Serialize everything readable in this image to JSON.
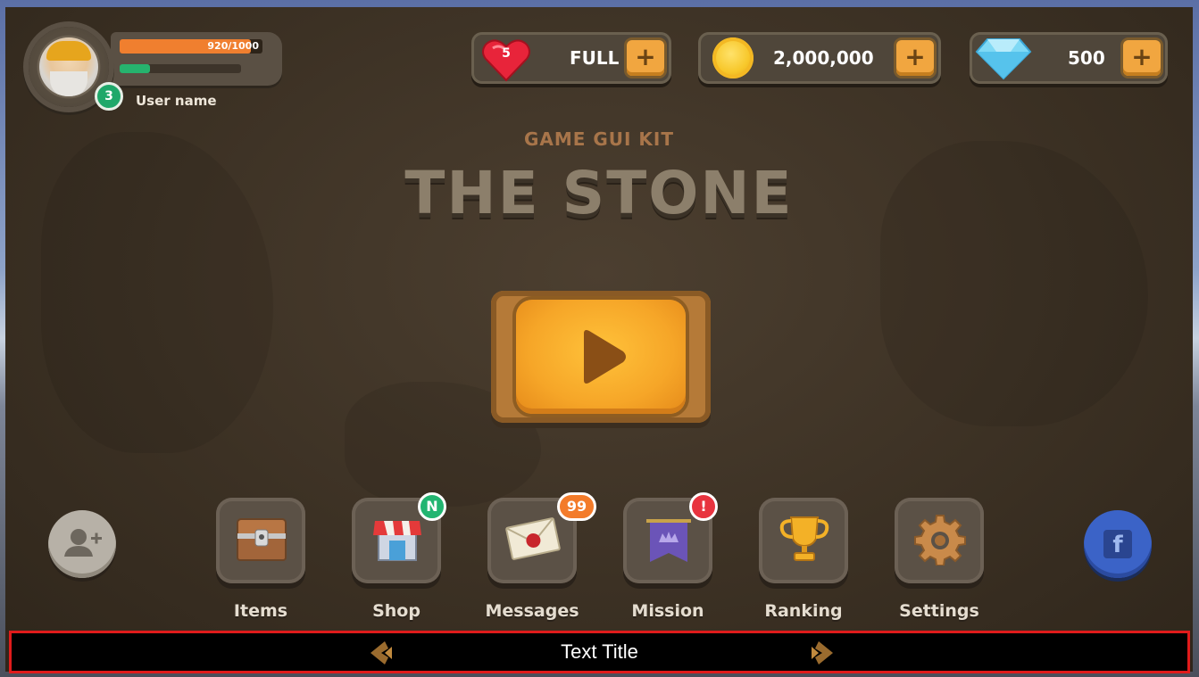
{
  "profile": {
    "level": "3",
    "username": "User name",
    "xp_text": "920/1000",
    "xp_fraction": 0.92,
    "secondary_fraction": 0.25
  },
  "resources": {
    "lives": {
      "icon": "heart-gem-icon",
      "count": "5",
      "status": "FULL",
      "add_label": "+"
    },
    "coins": {
      "icon": "coin-icon",
      "value": "2,000,000",
      "add_label": "+"
    },
    "gems": {
      "icon": "diamond-icon",
      "value": "500",
      "add_label": "+"
    }
  },
  "title": {
    "subtitle": "GAME GUI KIT",
    "main": "THE STONE"
  },
  "play": {
    "icon": "play-icon"
  },
  "menu": [
    {
      "label": "Items",
      "icon": "treasure-chest-icon"
    },
    {
      "label": "Shop",
      "icon": "shop-icon",
      "badge": "N"
    },
    {
      "label": "Messages",
      "icon": "envelope-icon",
      "badge": "99"
    },
    {
      "label": "Mission",
      "icon": "banner-icon",
      "badge": "!"
    },
    {
      "label": "Ranking",
      "icon": "trophy-icon"
    },
    {
      "label": "Settings",
      "icon": "gear-icon"
    }
  ],
  "side_buttons": {
    "add_friend_icon": "add-user-icon",
    "facebook_label": "f"
  },
  "bottom_bar": {
    "title": "Text Title"
  },
  "colors": {
    "accent": "#f6a628",
    "xp_bar": "#f07f2f",
    "level_badge": "#1fa86a",
    "bar_border": "#e01b1b"
  }
}
